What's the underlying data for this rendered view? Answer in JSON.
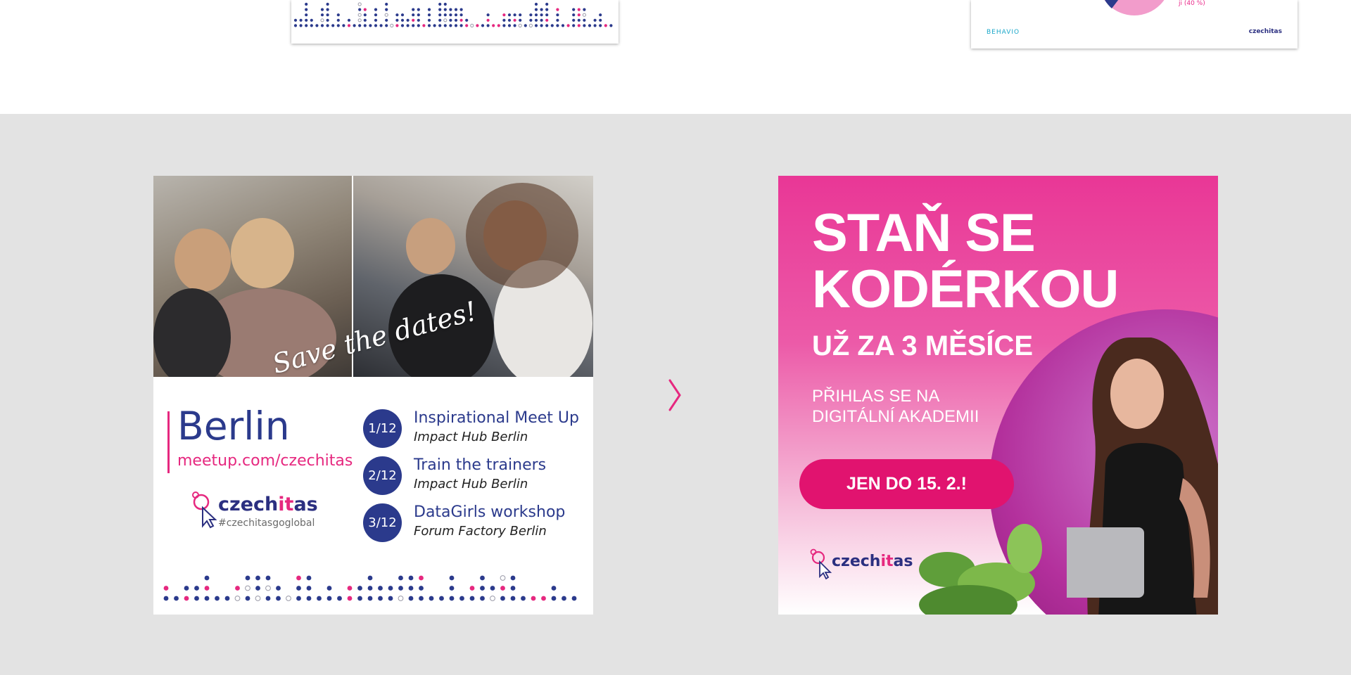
{
  "top_cards": {
    "left_card": {},
    "right_card": {
      "percent_label": "ji (40 %)",
      "behavio_logo": "BEHAVIO",
      "brand_logo": "czechitas"
    }
  },
  "berlin_card": {
    "overlay_text": "Save the dates!",
    "city": "Berlin",
    "url": "meetup.com/czechitas",
    "logo": {
      "word_start": "czech",
      "word_highlight": "it",
      "word_end": "as",
      "hashtag": "#czechitasgoglobal"
    },
    "events": [
      {
        "date": "1/12",
        "title": "Inspirational Meet Up",
        "place": "Impact Hub Berlin"
      },
      {
        "date": "2/12",
        "title": "Train the trainers",
        "place": "Impact Hub Berlin"
      },
      {
        "date": "3/12",
        "title": "DataGirls workshop",
        "place": "Forum Factory Berlin"
      }
    ]
  },
  "carousel": {
    "next_icon": "chevron-right-icon"
  },
  "promo_card": {
    "headline_line1": "STAŇ SE",
    "headline_line2": "KODÉRKOU",
    "subheadline": "UŽ ZA 3 MĚSÍCE",
    "body_line1": "PŘIHLAS SE NA",
    "body_line2": "DIGITÁLNÍ AKADEMII",
    "button_label": "JEN DO 15. 2.!",
    "logo": {
      "word_start": "czech",
      "word_highlight": "it",
      "word_end": "as"
    }
  },
  "colors": {
    "navy": "#2b3a8c",
    "pink": "#e6287f",
    "background_gray": "#e3e3e3"
  }
}
